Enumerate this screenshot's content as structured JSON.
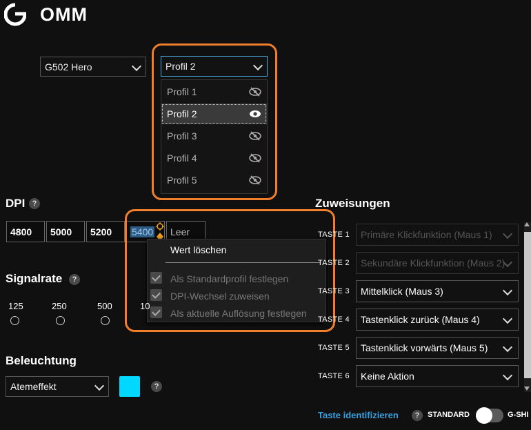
{
  "header": {
    "title": "OMM"
  },
  "device_select": {
    "value": "G502 Hero"
  },
  "profile": {
    "selected": "Profil 2",
    "items": [
      {
        "label": "Profil 1",
        "state": "hidden"
      },
      {
        "label": "Profil 2",
        "state": "visible"
      },
      {
        "label": "Profil 3",
        "state": "hidden"
      },
      {
        "label": "Profil 4",
        "state": "hidden"
      },
      {
        "label": "Profil 5",
        "state": "hidden"
      }
    ]
  },
  "dpi": {
    "title": "DPI",
    "help": "?",
    "values": [
      "4800",
      "5000",
      "5200",
      "5400"
    ],
    "empty_label": "Leer"
  },
  "context_menu": {
    "title": "Wert löschen",
    "items": [
      "Als Standardprofil festlegen",
      "DPI-Wechsel zuweisen",
      "Als aktuelle Auflösung festlegen"
    ]
  },
  "signal_rate": {
    "title": "Signalrate",
    "help": "?",
    "options": [
      "125",
      "250",
      "500",
      "10"
    ]
  },
  "lighting": {
    "title": "Beleuchtung",
    "effect": "Atemeffekt",
    "help": "?",
    "color": "#00d8ff"
  },
  "assignments": {
    "title": "Zuweisungen",
    "rows": [
      {
        "key": "TASTE 1",
        "value": "Primäre Klickfunktion (Maus 1)",
        "disabled": true
      },
      {
        "key": "TASTE 2",
        "value": "Sekundäre Klickfunktion (Maus 2)",
        "disabled": true
      },
      {
        "key": "TASTE 3",
        "value": "Mittelklick (Maus 3)",
        "disabled": false
      },
      {
        "key": "TASTE 4",
        "value": "Tastenklick zurück (Maus 4)",
        "disabled": false
      },
      {
        "key": "TASTE 5",
        "value": "Tastenklick vorwärts (Maus 5)",
        "disabled": false
      },
      {
        "key": "TASTE 6",
        "value": "Keine Aktion",
        "disabled": false
      }
    ],
    "identify_link": "Taste identifizieren",
    "help": "?",
    "standard_label": "STANDARD",
    "gshift_label": "G-SHI"
  },
  "colors": {
    "accent": "#3aa0e0",
    "highlight": "#f07e2a",
    "background": "#101010"
  }
}
